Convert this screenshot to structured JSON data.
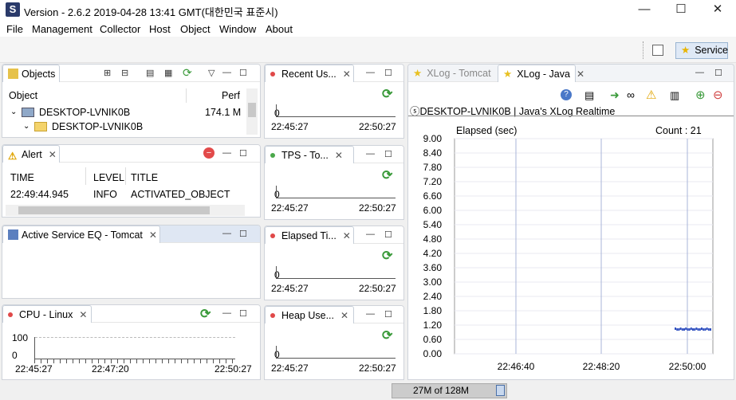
{
  "window": {
    "title": "Version - 2.6.2 2019-04-28 13:41 GMT(대한민국 표준시)",
    "app_icon": "scouter-logo-icon"
  },
  "menu": [
    "File",
    "Management",
    "Collector",
    "Host",
    "Object",
    "Window",
    "About"
  ],
  "toolbar": {
    "service_label": "Service"
  },
  "objects": {
    "tab": "Objects",
    "col_object": "Object",
    "col_perf": "Perf",
    "rows": [
      {
        "name": "DESKTOP-LVNIK0B",
        "perf": "174.1 M"
      },
      {
        "name": "DESKTOP-LVNIK0B",
        "perf": ""
      }
    ]
  },
  "alert": {
    "tab": "Alert",
    "cols": [
      "TIME",
      "LEVEL",
      "TITLE"
    ],
    "row": [
      "22:49:44.945",
      "INFO",
      "ACTIVATED_OBJECT"
    ]
  },
  "eq": {
    "tab": "Active Service EQ - Tomcat"
  },
  "cpu": {
    "tab": "CPU - Linux",
    "y_max": "100",
    "y_min": "0",
    "x_ticks": [
      "22:45:27",
      "22:47:20",
      "22:50:27"
    ]
  },
  "mini": [
    {
      "tab": "Recent Us...",
      "y": "0",
      "x_start": "22:45:27",
      "x_end": "22:50:27"
    },
    {
      "tab": "TPS - To...",
      "y": "0",
      "x_start": "22:45:27",
      "x_end": "22:50:27"
    },
    {
      "tab": "Elapsed Ti...",
      "y": "0",
      "x_start": "22:45:27",
      "x_end": "22:50:27"
    },
    {
      "tab": "Heap Use...",
      "y": "0",
      "x_start": "22:45:27",
      "x_end": "22:50:27"
    }
  ],
  "xlog": {
    "tab_inactive": "XLog - Tomcat",
    "tab_active": "XLog - Java",
    "header": "ⓢDESKTOP-LVNIK0B | Java's XLog Realtime",
    "ylabel": "Elapsed (sec)",
    "count": "Count : 21",
    "y_ticks": [
      "9.00",
      "8.40",
      "7.80",
      "7.20",
      "6.60",
      "6.00",
      "5.40",
      "4.80",
      "4.20",
      "3.60",
      "3.00",
      "2.40",
      "1.80",
      "1.20",
      "0.60",
      "0.00"
    ],
    "x_ticks": [
      "22:46:40",
      "22:48:20",
      "22:50:00"
    ]
  },
  "status": {
    "memory": "27M of 128M"
  },
  "chart_data": {
    "type": "scatter",
    "ylabel": "Elapsed (sec)",
    "ylim": [
      0,
      9
    ],
    "x_ticks": [
      "22:46:40",
      "22:48:20",
      "22:50:00"
    ],
    "count": 21,
    "points_note_value": 1.0
  }
}
